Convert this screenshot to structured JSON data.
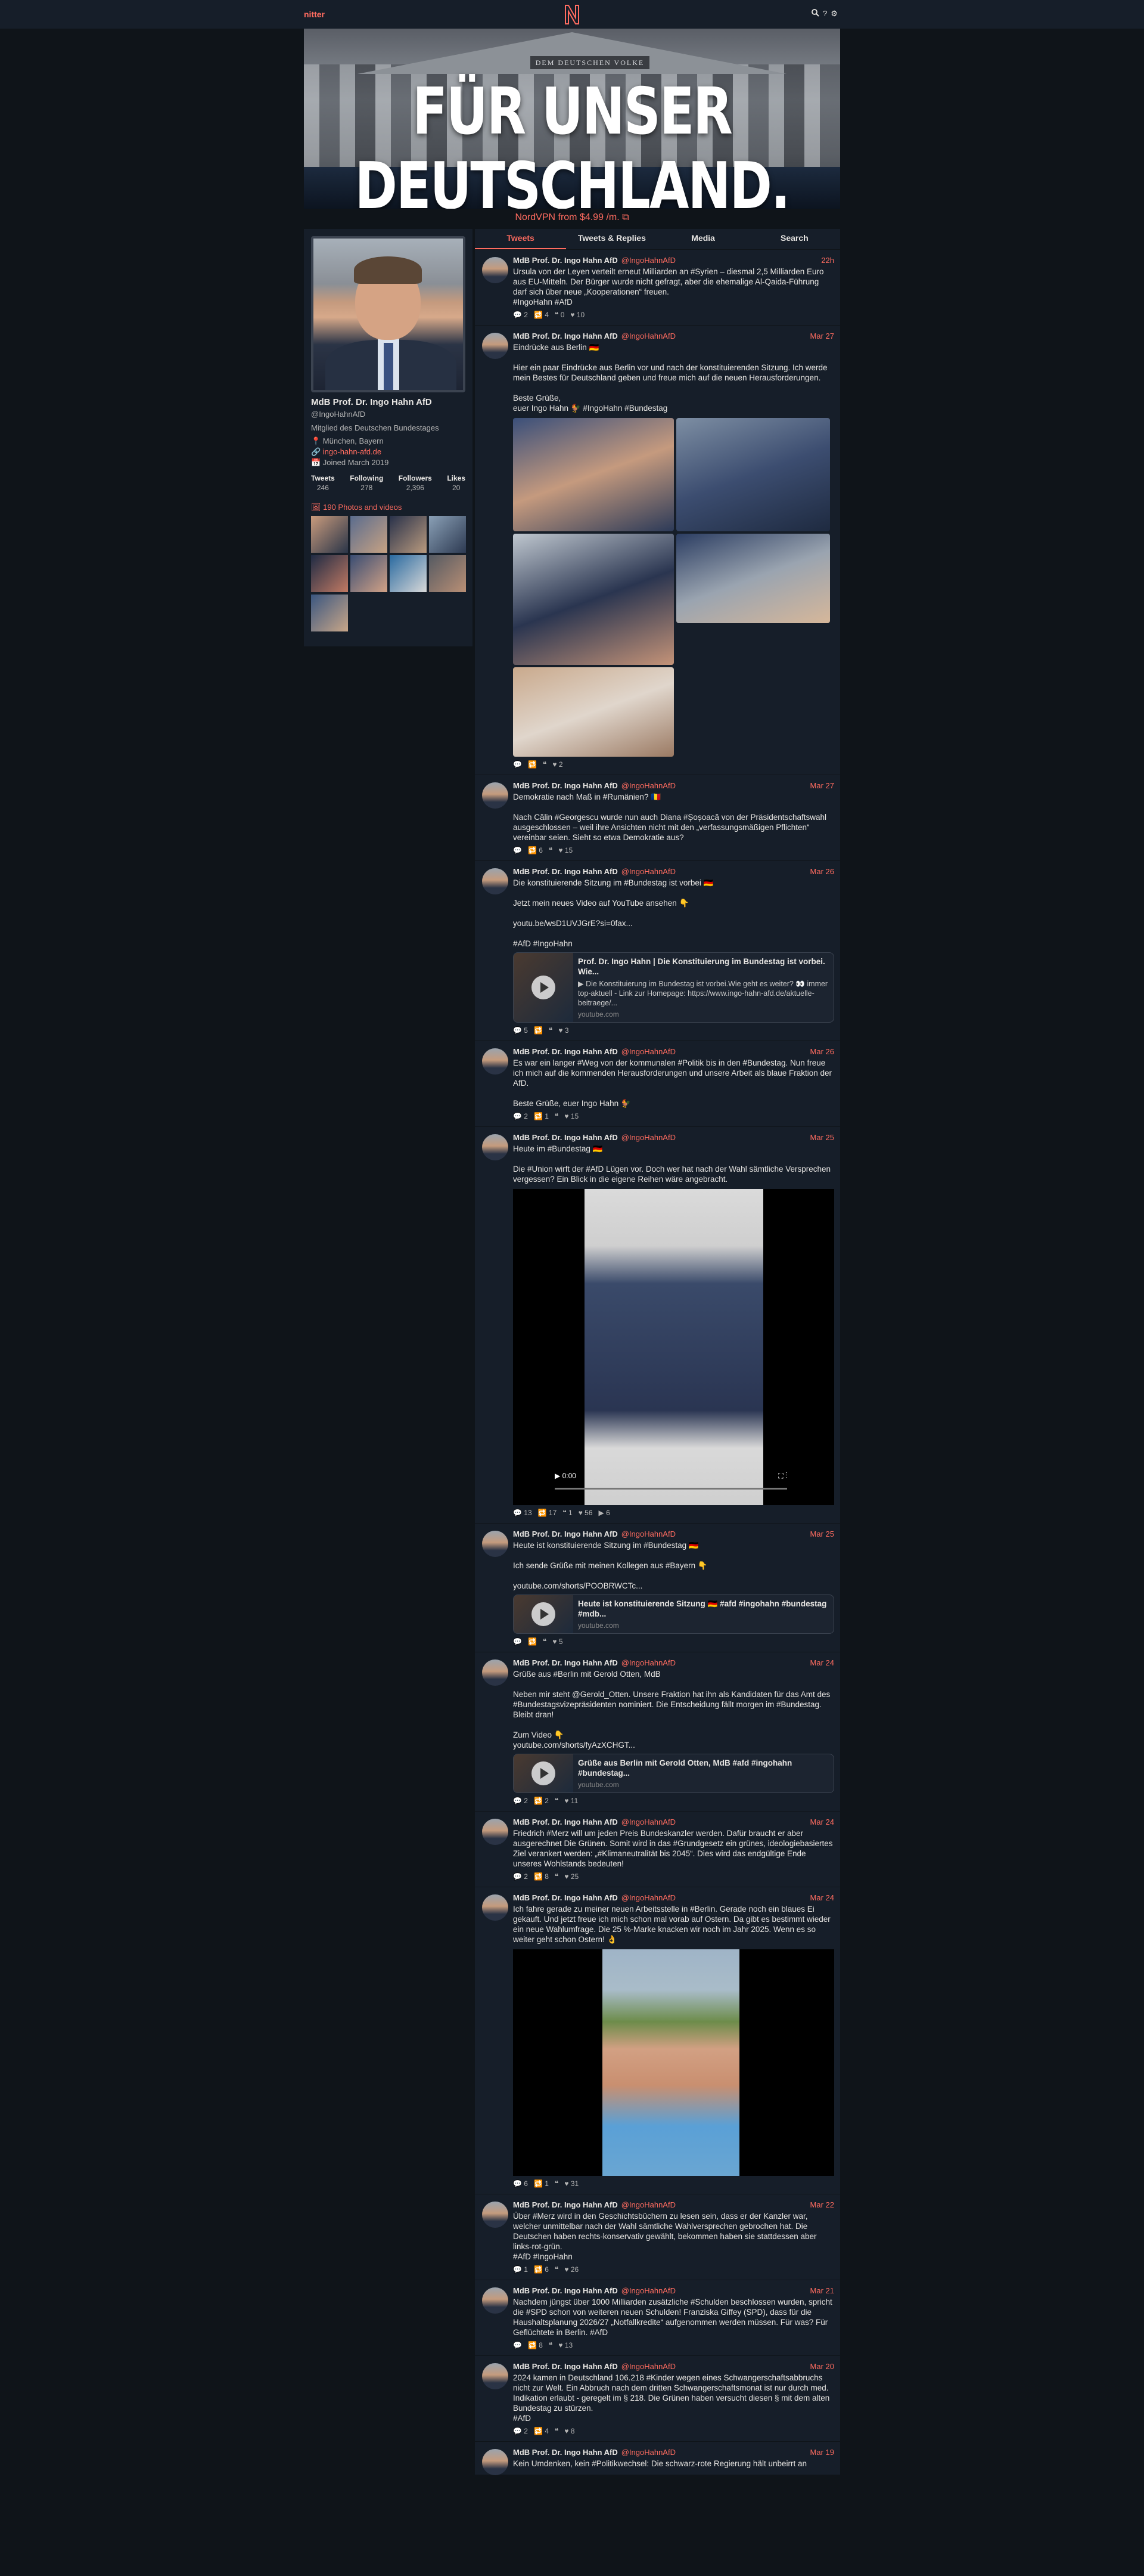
{
  "nav": {
    "brand": "nitter",
    "icons": [
      "search-icon",
      "help-icon",
      "settings-icon"
    ]
  },
  "banner": {
    "inscription": "DEM DEUTSCHEN VOLKE",
    "title": "FÜR UNSER DEUTSCHLAND."
  },
  "promo": "NordVPN from $4.99 /m. ⧉",
  "profile": {
    "fullname": "MdB Prof. Dr. Ingo Hahn AfD",
    "username": "@IngoHahnAfD",
    "bio": "Mitglied des Deutschen Bundestages",
    "location": "📍 München, Bayern",
    "website": "🔗 ingo-hahn-afd.de",
    "joined": "📅 Joined March 2019",
    "stats": [
      {
        "label": "Tweets",
        "value": "246"
      },
      {
        "label": "Following",
        "value": "278"
      },
      {
        "label": "Followers",
        "value": "2,396"
      },
      {
        "label": "Likes",
        "value": "20"
      }
    ],
    "media_label": "🖼 190 Photos and videos"
  },
  "tabs": [
    {
      "label": "Tweets",
      "active": true
    },
    {
      "label": "Tweets & Replies"
    },
    {
      "label": "Media"
    },
    {
      "label": "Search"
    }
  ],
  "author": {
    "name": "MdB Prof. Dr. Ingo Hahn AfD",
    "username": "@IngoHahnAfD"
  },
  "tweets": [
    {
      "date": "22h",
      "text": "Ursula von der Leyen verteilt erneut Milliarden an #Syrien – diesmal 2,5 Milliarden Euro aus EU-Mitteln. Der Bürger wurde nicht gefragt, aber die ehemalige Al-Qaida-Führung darf sich über neue „Kooperationen“ freuen.\n#IngoHahn #AfD",
      "stats": [
        "💬 2",
        "🔁 4",
        "❝ 0",
        "♥ 10"
      ]
    },
    {
      "date": "Mar 27",
      "text": "Eindrücke aus Berlin 🇩🇪\n\nHier ein paar Eindrücke aus Berlin vor und nach der konstituierenden Sitzung. Ich werde mein Bestes für Deutschland geben und freue mich auf die neuen Herausforderungen.\n\nBeste Grüße,\neuer Ingo Hahn 🐓 #IngoHahn #Bundestag",
      "stats": [
        "💬",
        "🔁",
        "❝",
        "♥ 2"
      ]
    },
    {
      "date": "Mar 27",
      "text": "Demokratie nach Maß in #Rumänien? 🇷🇴\n\nNach Călin #Georgescu wurde nun auch Diana #Șoșoacă von der Präsidentschaftswahl ausgeschlossen – weil ihre Ansichten nicht mit den „verfassungsmäßigen Pflichten“ vereinbar seien. Sieht so etwa Demokratie aus?",
      "stats": [
        "💬",
        "🔁 6",
        "❝",
        "♥ 15"
      ]
    },
    {
      "date": "Mar 26",
      "text": "Die konstituierende Sitzung im #Bundestag ist vorbei 🇩🇪\n\nJetzt mein neues Video auf YouTube ansehen 👇\n\nyoutu.be/wsD1UVJGrE?si=0fax...\n\n#AfD #IngoHahn",
      "card": {
        "title": "Prof. Dr. Ingo Hahn | Die Konstituierung im Bundestag ist vorbei. Wie...",
        "desc": "▶ Die Konstituierung im Bundestag ist vorbei.Wie geht es weiter? 👀 immer top-aktuell - Link zur Homepage: https://www.ingo-hahn-afd.de/aktuelle-beitraege/...",
        "dest": "youtube.com"
      },
      "stats": [
        "💬 5",
        "🔁",
        "❝",
        "♥ 3"
      ]
    },
    {
      "date": "Mar 26",
      "text": "Es war ein langer #Weg von der kommunalen #Politik bis in den #Bundestag. Nun freue ich mich auf die kommenden Herausforderungen und unsere Arbeit als blaue Fraktion der AfD.\n\nBeste Grüße, euer Ingo Hahn 🐓",
      "stats": [
        "💬 2",
        "🔁 1",
        "❝",
        "♥ 15"
      ]
    },
    {
      "date": "Mar 25",
      "text": "Heute im #Bundestag 🇩🇪\n\nDie #Union wirft der #AfD Lügen vor. Doch wer hat nach der Wahl sämtliche Versprechen vergessen? Ein Blick in die eigene Reihen wäre angebracht.",
      "video": {
        "time": "0:00"
      },
      "stats": [
        "💬 13",
        "🔁 17",
        "❝ 1",
        "♥ 56",
        "▶ 6"
      ]
    },
    {
      "date": "Mar 25",
      "text": "Heute ist konstituierende Sitzung im #Bundestag 🇩🇪\n\nIch sende Grüße mit meinen Kollegen aus #Bayern 👇\n\nyoutube.com/shorts/POOBRWCTc...",
      "card": {
        "title": "Heute ist konstituierende Sitzung 🇩🇪 #afd #ingohahn #bundestag #mdb...",
        "desc": "",
        "dest": "youtube.com"
      },
      "stats": [
        "💬",
        "🔁",
        "❝",
        "♥ 5"
      ]
    },
    {
      "date": "Mar 24",
      "text": "Grüße aus #Berlin mit Gerold Otten, MdB\n\nNeben mir steht @Gerold_Otten. Unsere Fraktion hat ihn als Kandidaten für das Amt des #Bundestagsvizepräsidenten nominiert. Die Entscheidung fällt morgen im #Bundestag. Bleibt dran!\n\nZum Video 👇\nyoutube.com/shorts/fyAzXCHGT...",
      "card": {
        "title": "Grüße aus Berlin mit Gerold Otten, MdB #afd #ingohahn #bundestag...",
        "desc": "",
        "dest": "youtube.com"
      },
      "stats": [
        "💬 2",
        "🔁 2",
        "❝",
        "♥ 11"
      ]
    },
    {
      "date": "Mar 24",
      "text": "Friedrich #Merz will um jeden Preis Bundeskanzler werden. Dafür braucht er aber ausgerechnet Die Grünen. Somit wird in das #Grundgesetz ein grünes, ideologiebasiertes Ziel verankert werden: „#Klimaneutralität bis 2045“. Dies wird das endgültige Ende unseres Wohlstands bedeuten!",
      "stats": [
        "💬 2",
        "🔁 8",
        "❝",
        "♥ 25"
      ]
    },
    {
      "date": "Mar 24",
      "text": "Ich fahre gerade zu meiner neuen Arbeitsstelle in #Berlin. Gerade noch ein blaues Ei gekauft. Und jetzt freue ich mich schon mal vorab auf Ostern. Da gibt es bestimmt wieder ein neue Wahlumfrage. Die 25 %-Marke knacken wir noch im Jahr 2025. Wenn es so weiter geht schon Ostern! 👌",
      "photo": true,
      "stats": [
        "💬 6",
        "🔁 1",
        "❝",
        "♥ 31"
      ]
    },
    {
      "date": "Mar 22",
      "text": "Über #Merz wird in den Geschichtsbüchern zu lesen sein, dass er der Kanzler war, welcher unmittelbar nach der Wahl sämtliche Wahlversprechen gebrochen hat. Die Deutschen haben rechts-konservativ gewählt, bekommen haben sie stattdessen aber links-rot-grün.\n#AfD #IngoHahn",
      "stats": [
        "💬 1",
        "🔁 6",
        "❝",
        "♥ 26"
      ]
    },
    {
      "date": "Mar 21",
      "text": "Nachdem jüngst über 1000 Milliarden zusätzliche #Schulden beschlossen wurden, spricht die #SPD schon von weiteren neuen Schulden! Franziska Giffey (SPD), dass für die Haushaltsplanung 2026/27 „Notfallkredite“ aufgenommen werden müssen. Für was? Für Geflüchtete in Berlin. #AfD",
      "stats": [
        "💬",
        "🔁 8",
        "❝",
        "♥ 13"
      ]
    },
    {
      "date": "Mar 20",
      "text": "2024 kamen in Deutschland 106.218 #Kinder wegen eines Schwangerschaftsabbruchs nicht zur Welt. Ein Abbruch nach dem dritten Schwangerschaftsmonat ist nur durch med. Indikation erlaubt - geregelt im § 218. Die Grünen haben versucht diesen § mit dem alten Bundestag zu stürzen.\n#AfD",
      "stats": [
        "💬 2",
        "🔁 4",
        "❝",
        "♥ 8"
      ]
    },
    {
      "date": "Mar 19",
      "text": "Kein Umdenken, kein #Politikwechsel: Die schwarz-rote Regierung hält unbeirrt an",
      "stats": []
    }
  ]
}
